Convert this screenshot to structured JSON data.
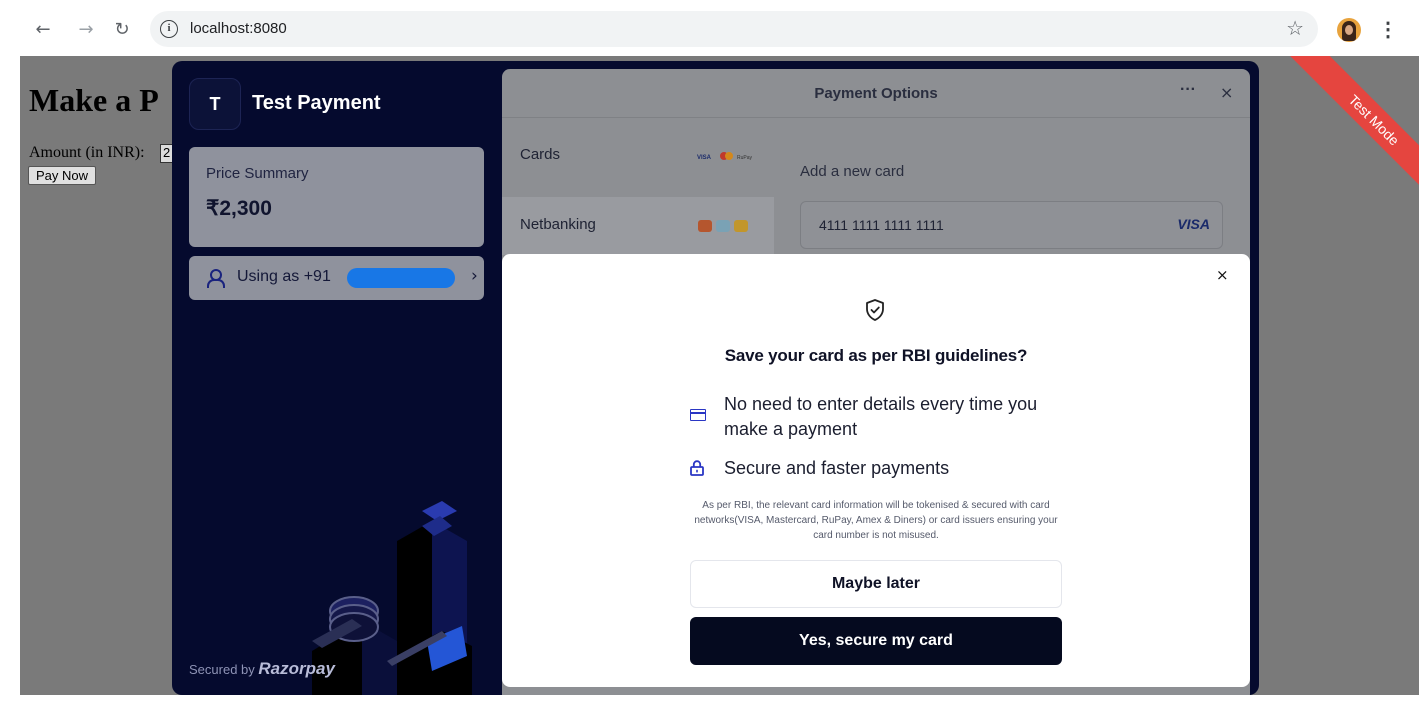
{
  "browser": {
    "url": "localhost:8080"
  },
  "page": {
    "title": "Make a P",
    "amount_label": "Amount (in INR):",
    "amount_value": "2",
    "pay_button": "Pay Now"
  },
  "checkout": {
    "brand_initial": "T",
    "brand_name": "Test Payment",
    "price_label": "Price Summary",
    "price_value": "₹2,300",
    "using_as": "Using as +91",
    "secured_prefix": "Secured by",
    "secured_brand": "Razorpay",
    "panel_title": "Payment Options",
    "panel_more": "···",
    "panel_close": "×",
    "methods": [
      {
        "label": "Cards"
      },
      {
        "label": "Netbanking"
      }
    ],
    "card_logos": "VISA ● RuPay",
    "add_card_label": "Add a new card",
    "card_number": "4111 1111 1111 1111",
    "card_network": "VISA",
    "test_mode": "Test Mode"
  },
  "modal": {
    "close": "×",
    "title": "Save your card as per RBI guidelines?",
    "benefits": [
      {
        "icon": "card-icon",
        "text": "No need to enter details every time you make a payment"
      },
      {
        "icon": "lock-icon",
        "text": "Secure and faster payments"
      }
    ],
    "fine_print": "As per RBI, the relevant card information will be tokenised & secured with card networks(VISA, Mastercard, RuPay, Amex & Diners) or card issuers ensuring your card number is not misused.",
    "secondary_button": "Maybe later",
    "primary_button": "Yes, secure my card"
  },
  "colors": {
    "checkout_bg": "#050a2e",
    "primary_button": "#050a1f",
    "ribbon": "#e5453f",
    "redaction": "#1877e6",
    "icon_accent": "#2a36c4"
  }
}
